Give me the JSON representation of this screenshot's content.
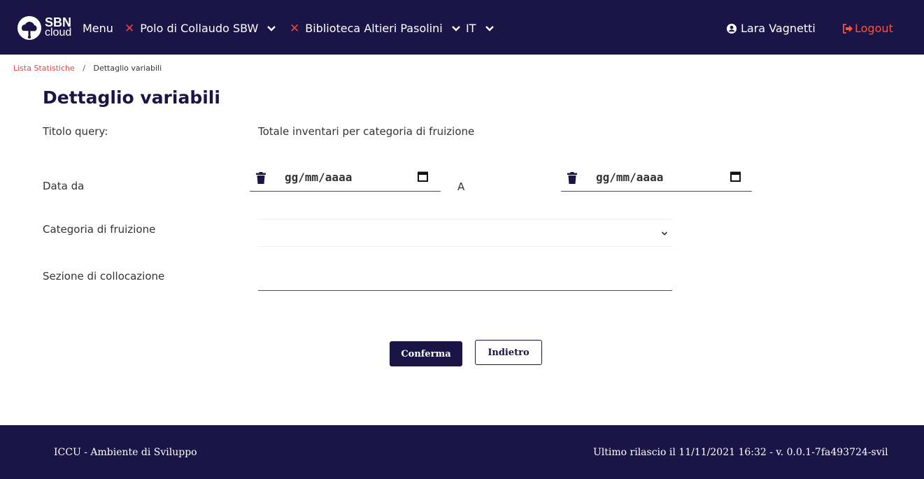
{
  "header": {
    "logo_top": "SBN",
    "logo_bottom": "cloud",
    "menu_label": "Menu",
    "polo_label": "Polo di Collaudo SBW",
    "biblioteca_label": "Biblioteca Altieri Pasolini",
    "language_label": "IT",
    "user_name": "Lara Vagnetti",
    "logout_label": "Logout",
    "accent_color": "#e8463f",
    "bg_color": "#1b1547"
  },
  "breadcrumb": {
    "parent": "Lista Statistiche",
    "separator": "/",
    "current": "Dettaglio variabili"
  },
  "page": {
    "title": "Dettaglio variabili"
  },
  "form": {
    "titolo_label": "Titolo query:",
    "titolo_value": "Totale inventari per categoria di fruizione",
    "data_da_label": "Data da",
    "data_from_placeholder": "gg/mm/aaaa",
    "range_separator": "A",
    "data_to_placeholder": "gg/mm/aaaa",
    "categoria_label": "Categoria di fruizione",
    "categoria_value": "",
    "sezione_label": "Sezione di collocazione",
    "sezione_value": ""
  },
  "actions": {
    "confirm_label": "Conferma",
    "back_label": "Indietro"
  },
  "footer": {
    "environment": "ICCU - Ambiente di Sviluppo",
    "release": "Ultimo rilascio il 11/11/2021 16:32 - v. 0.0.1-7fa493724-svil"
  }
}
